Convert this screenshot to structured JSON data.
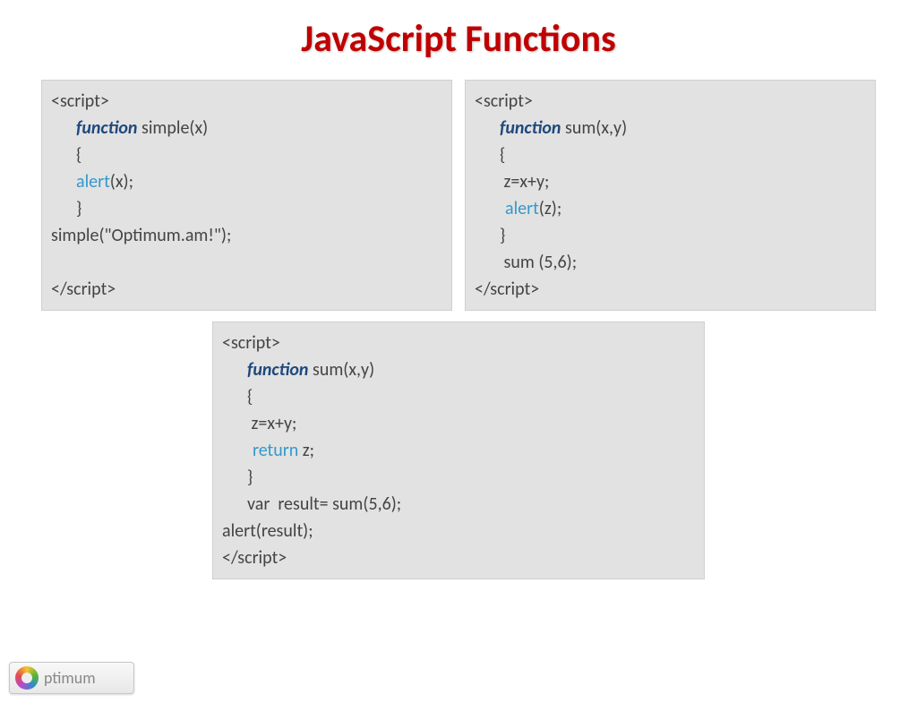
{
  "title": "JavaScript Functions",
  "box1": {
    "l1": "<script>",
    "l2_kw": "function",
    "l2_rest": " simple(x)",
    "l3": "{",
    "l4_fn": "alert",
    "l4_rest": "(x);",
    "l5": "}",
    "l6": "simple(\"Optimum.am!\");",
    "l7": "",
    "l8": "</script>"
  },
  "box2": {
    "l1": "<script>",
    "l2_kw": "function",
    "l2_rest": " sum(x,y)",
    "l3": "{",
    "l4": " z=x+y;",
    "l5_fn": "alert",
    "l5_rest": "(z);",
    "l6": "}",
    "l7": " sum (5,6);",
    "l8": "</script>"
  },
  "box3": {
    "l1": "<script>",
    "l2_kw": "function",
    "l2_rest": " sum(x,y)",
    "l3": "{",
    "l4": " z=x+y;",
    "l5_fn": "return",
    "l5_rest": " z;",
    "l6": "}",
    "l7": "var  result= sum(5,6);",
    "l8": "alert(result);",
    "l9": "</script>"
  },
  "watermark": "ptimum"
}
